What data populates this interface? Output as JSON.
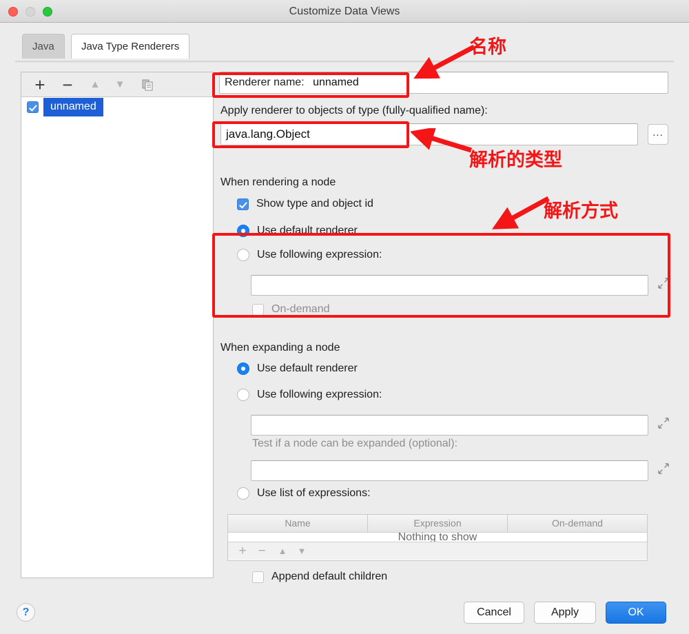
{
  "window": {
    "title": "Customize Data Views",
    "controls": [
      "close-button",
      "minimize-button",
      "maximize-button"
    ]
  },
  "tabs": [
    {
      "label": "Java",
      "active": false
    },
    {
      "label": "Java Type Renderers",
      "active": true
    }
  ],
  "list_panel": {
    "toolbar": {
      "add": "+",
      "remove": "−",
      "move_up": "▲",
      "move_down": "▼",
      "duplicate": "duplicate-icon"
    },
    "items": [
      {
        "label": "unnamed",
        "checked": true,
        "selected": true
      }
    ]
  },
  "renderer": {
    "name_label": "Renderer name:",
    "name_value": "unnamed",
    "type_label": "Apply renderer to objects of type (fully-qualified name):",
    "type_value": "java.lang.Object",
    "browse_button": "..."
  },
  "rendering_section": {
    "title": "When rendering a node",
    "show_type_checkbox": {
      "label": "Show type and object id",
      "checked": true
    },
    "options": [
      {
        "label": "Use default renderer",
        "selected": true
      },
      {
        "label": "Use following expression:",
        "selected": false
      }
    ],
    "expression_value": "",
    "on_demand": {
      "label": "On-demand",
      "checked": false,
      "disabled": true
    },
    "expand_icon": "expand-editor-icon"
  },
  "expanding_section": {
    "title": "When expanding a node",
    "options": [
      {
        "label": "Use default renderer",
        "selected": true
      },
      {
        "label": "Use following expression:",
        "selected": false
      },
      {
        "label": "Use list of expressions:",
        "selected": false
      }
    ],
    "expression_value": "",
    "test_label": "Test if a node can be expanded (optional):",
    "test_value": "",
    "expand_icon": "expand-editor-icon",
    "table": {
      "columns": [
        "Name",
        "Expression",
        "On-demand"
      ],
      "rows": [],
      "empty_text": "Nothing to show",
      "toolbar": {
        "add": "+",
        "remove": "−",
        "move_up": "▲",
        "move_down": "▼"
      }
    },
    "append_children": {
      "label": "Append default children",
      "checked": false,
      "disabled": true
    }
  },
  "footer": {
    "help": "?",
    "cancel": "Cancel",
    "apply": "Apply",
    "ok": "OK"
  },
  "annotations": {
    "accent_color": "#f41616",
    "items": [
      {
        "text": "名称",
        "target": "renderer-name-field"
      },
      {
        "text": "解析的类型",
        "target": "renderer-type-field"
      },
      {
        "text": "解析方式",
        "target": "rendering-expression-group"
      }
    ]
  }
}
